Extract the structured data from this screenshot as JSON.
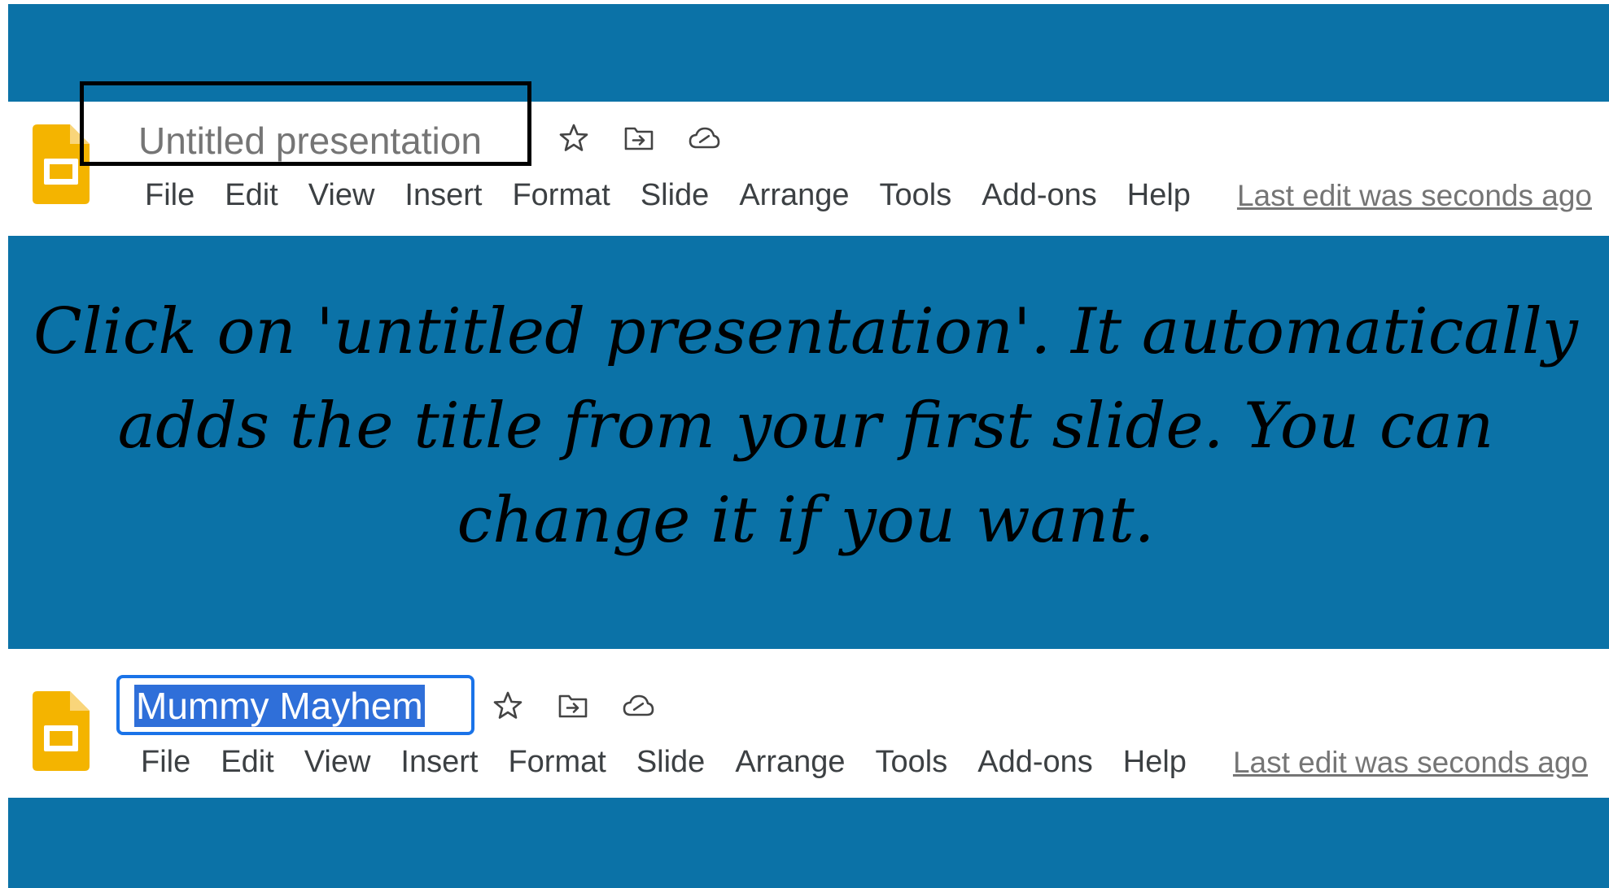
{
  "instruction": {
    "text": "Click on 'untitled presentation'. It automatically adds the title from your first slide. You can change it if you want."
  },
  "example_before": {
    "title": "Untitled presentation",
    "menu": [
      "File",
      "Edit",
      "View",
      "Insert",
      "Format",
      "Slide",
      "Arrange",
      "Tools",
      "Add-ons",
      "Help"
    ],
    "last_edit": "Last edit was seconds ago",
    "icons": [
      "star-icon",
      "move-to-folder-icon",
      "cloud-status-icon"
    ]
  },
  "example_after": {
    "title_value": "Mummy Mayhem",
    "menu": [
      "File",
      "Edit",
      "View",
      "Insert",
      "Format",
      "Slide",
      "Arrange",
      "Tools",
      "Add-ons",
      "Help"
    ],
    "last_edit": "Last edit was seconds ago",
    "icons": [
      "star-icon",
      "move-to-folder-icon",
      "cloud-status-icon"
    ]
  },
  "colors": {
    "slide_background": "#0b72a7",
    "slides_logo": "#f4b400",
    "selection": "#2f6fd9",
    "focus_border": "#1a73e8"
  }
}
